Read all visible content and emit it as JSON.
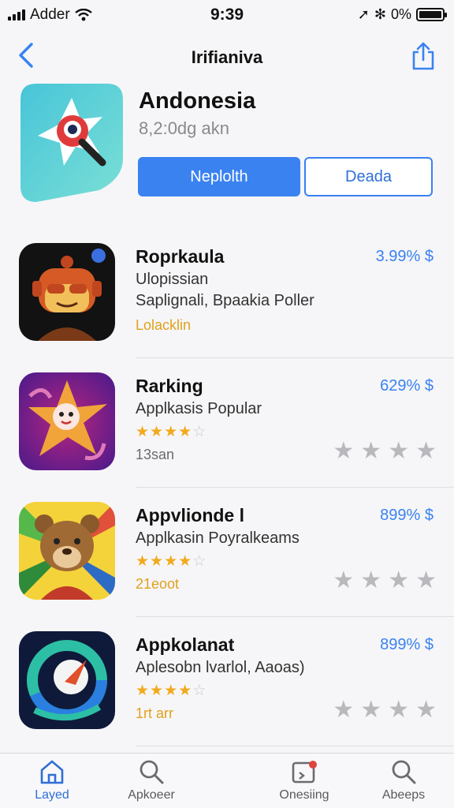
{
  "status_bar": {
    "carrier": "Adder",
    "time": "9:39",
    "battery": "0%"
  },
  "nav": {
    "title": "Irifianiva"
  },
  "hero": {
    "title": "Andonesia",
    "subtitle": "8,2:0dg akn",
    "primary_button": "Neplolth",
    "secondary_button": "Deada"
  },
  "apps": [
    {
      "name": "Roprkaula",
      "subtitle": "Ulopissian",
      "line3": "Saplignali, Bpaakia Poller",
      "meta": "Lolacklin",
      "price": "3.99% $"
    },
    {
      "name": "Rarking",
      "subtitle": "Applkasis Popular",
      "rating": 3.5,
      "meta": "13san",
      "price": "629% $"
    },
    {
      "name": "Appvlionde l",
      "subtitle": "Applkasin Poyralkeams",
      "rating": 3.5,
      "meta": "21eoot",
      "price": "899% $"
    },
    {
      "name": "Appkolanat",
      "subtitle": "Aplesobn lvarlol, Aaoas)",
      "rating": 3.5,
      "meta": "1rt arr",
      "price": "899% $"
    }
  ],
  "tabs": [
    {
      "label": "Layed",
      "icon": "home-icon",
      "active": true
    },
    {
      "label": "Apkoeer",
      "icon": "search-icon",
      "active": false
    },
    {
      "label": "Onesiing",
      "icon": "updates-icon",
      "active": false
    },
    {
      "label": "Abeeps",
      "icon": "search-icon",
      "active": false
    }
  ],
  "colors": {
    "accent": "#3a82f0",
    "star": "#f2a91c",
    "meta_gold": "#e0a11b"
  }
}
